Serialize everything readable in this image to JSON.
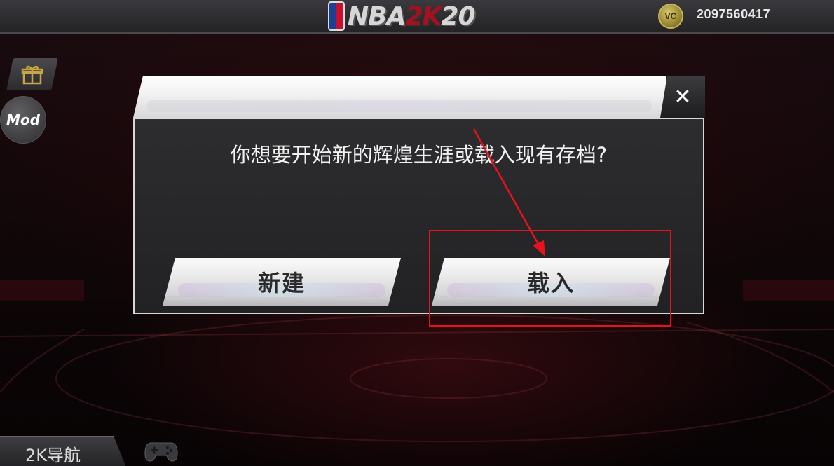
{
  "topbar": {
    "logo": {
      "nba": "NBA",
      "twok": "2K",
      "year": "20"
    },
    "vc_badge": "VC",
    "vc_amount": "2097560417"
  },
  "side": {
    "mod_label": "Mod"
  },
  "dialog": {
    "message": "你想要开始新的辉煌生涯或载入现有存档?",
    "close_symbol": "✕",
    "new_label": "新建",
    "load_label": "载入"
  },
  "bottom": {
    "nav_label": "2K导航"
  },
  "colors": {
    "highlight": "#e8121e",
    "dialog_bg": "#262628",
    "button_face": "#e6e6e8"
  },
  "icons": [
    "gift-icon",
    "gamepad-icon",
    "close-icon",
    "vc-coin-icon"
  ]
}
